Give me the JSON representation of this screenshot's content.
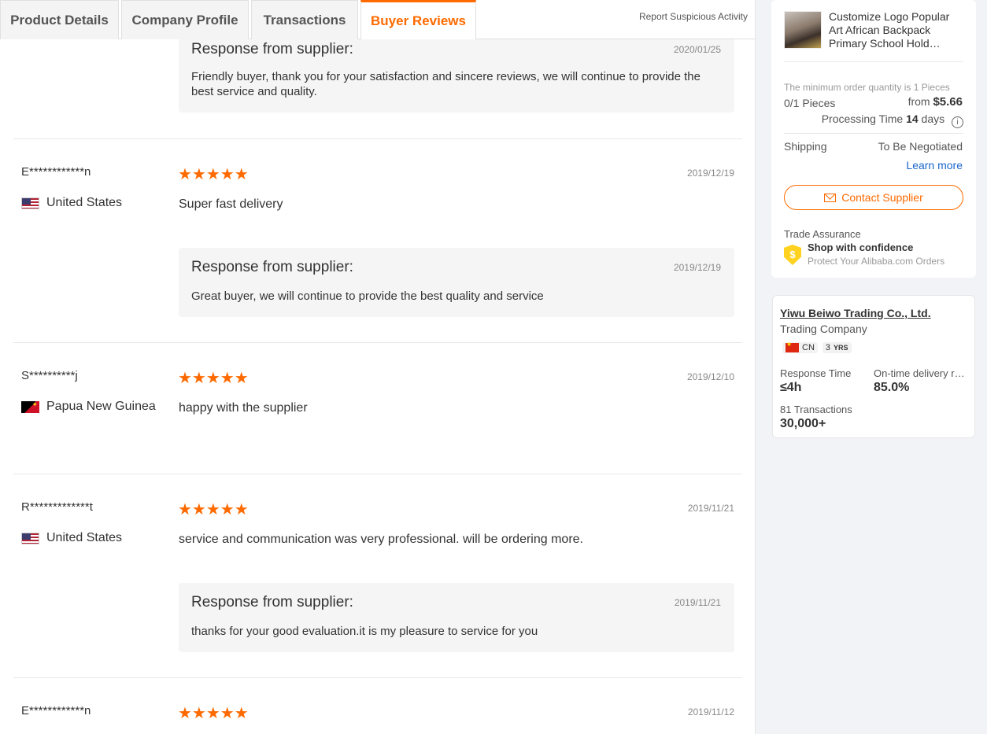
{
  "tabs": {
    "items": [
      {
        "label": "Product Details"
      },
      {
        "label": "Company Profile"
      },
      {
        "label": "Transactions"
      },
      {
        "label": "Buyer Reviews"
      }
    ],
    "report": "Report Suspicious Activity"
  },
  "reviews": {
    "top_response": {
      "title": "Response from supplier:",
      "date": "2020/01/25",
      "text": "Friendly buyer, thank you for your satisfaction and sincere reviews, we will continue to provide the best service and quality."
    },
    "items": [
      {
        "name": "E************n",
        "country": "United States",
        "stars": "★★★★★",
        "date": "2019/12/19",
        "comment": "Super fast delivery",
        "response": {
          "title": "Response from supplier:",
          "date": "2019/12/19",
          "text": "Great buyer, we will continue to provide the best quality and service"
        }
      },
      {
        "name": "S**********j",
        "country": "Papua New Guinea",
        "stars": "★★★★★",
        "date": "2019/12/10",
        "comment": "happy with the supplier"
      },
      {
        "name": "R*************t",
        "country": "United States",
        "stars": "★★★★★",
        "date": "2019/11/21",
        "comment": "service and communication was very professional. will be ordering more.",
        "response": {
          "title": "Response from supplier:",
          "date": "2019/11/21",
          "text": "thanks for your good evaluation.it is my pleasure to service for you"
        }
      },
      {
        "name": "E************n",
        "stars": "★★★★★",
        "date": "2019/11/12"
      }
    ]
  },
  "order_card": {
    "product_title": "Customize Logo Popular Art African Backpack Primary School Hold…",
    "min_order": "The minimum order quantity is 1 Pieces",
    "quantity": "0/1 Pieces",
    "price_prefix": "from",
    "price": "$5.66",
    "processing_label": "Processing Time",
    "processing_value": "14",
    "processing_unit": "days",
    "shipping_label": "Shipping",
    "shipping_value": "To Be Negotiated",
    "learn_more": "Learn more",
    "contact": "Contact Supplier",
    "trade_assurance": "Trade Assurance",
    "shop_confidence": "Shop with confidence",
    "protect": "Protect Your Alibaba.com Orders"
  },
  "company_card": {
    "name": "Yiwu Beiwo Trading Co., Ltd.",
    "type": "Trading Company",
    "country_code": "CN",
    "years": "3",
    "years_unit": "YRS",
    "response_time_label": "Response Time",
    "response_time_value": "≤4h",
    "ontime_label": "On-time delivery r…",
    "ontime_value": "85.0%",
    "transactions_label": "81 Transactions",
    "transactions_value": "30,000+"
  },
  "colors": {
    "accent": "#ff6a00",
    "link": "#1a66cc"
  }
}
